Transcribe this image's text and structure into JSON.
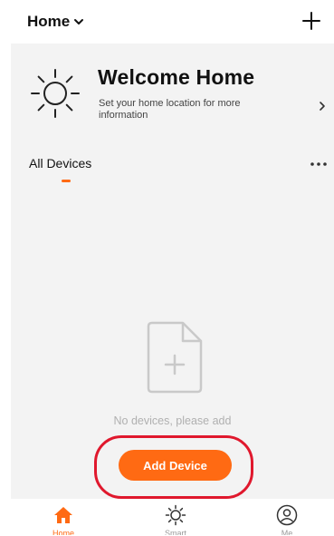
{
  "header": {
    "home_label": "Home",
    "home_dropdown_icon": "chevron-down-icon",
    "add_icon": "plus-icon"
  },
  "welcome": {
    "title": "Welcome Home",
    "subtitle": "Set your home location for more information",
    "weather_icon": "sun-icon"
  },
  "devices": {
    "tab_label": "All Devices",
    "empty_text": "No devices, please add",
    "add_button_label": "Add Device"
  },
  "bottom_nav": {
    "items": [
      {
        "label": "Home",
        "icon": "home-icon",
        "active": true
      },
      {
        "label": "Smart",
        "icon": "sun-icon",
        "active": false
      },
      {
        "label": "Me",
        "icon": "user-icon",
        "active": false
      }
    ]
  },
  "colors": {
    "accent": "#ff6a13",
    "highlight": "#e0182d",
    "content_bg": "#f3f3f3"
  }
}
